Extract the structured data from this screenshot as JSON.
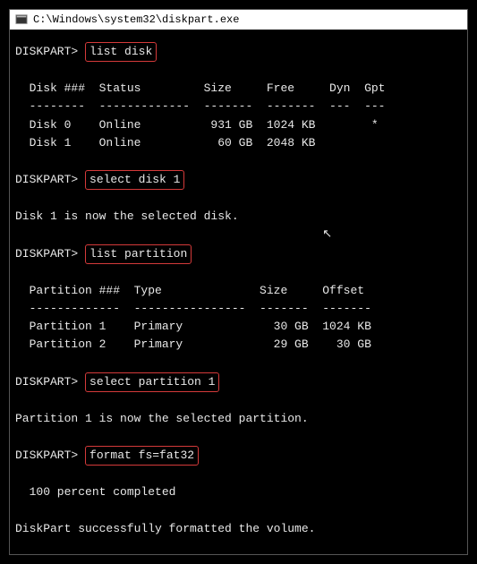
{
  "window": {
    "title": "C:\\Windows\\system32\\diskpart.exe"
  },
  "prompt": "DISKPART>",
  "commands": {
    "c1": "list disk",
    "c2": "select disk 1",
    "c3": "list partition",
    "c4": "select partition 1",
    "c5": "format fs=fat32"
  },
  "disk_table": {
    "header": "  Disk ###  Status         Size     Free     Dyn  Gpt",
    "divider": "  --------  -------------  -------  -------  ---  ---",
    "rows": [
      "  Disk 0    Online          931 GB  1024 KB        *",
      "  Disk 1    Online           60 GB  2048 KB"
    ]
  },
  "msg_disk_selected": "Disk 1 is now the selected disk.",
  "partition_table": {
    "header": "  Partition ###  Type              Size     Offset",
    "divider": "  -------------  ----------------  -------  -------",
    "rows": [
      "  Partition 1    Primary             30 GB  1024 KB",
      "  Partition 2    Primary             29 GB    30 GB"
    ]
  },
  "msg_partition_selected": "Partition 1 is now the selected partition.",
  "progress": "  100 percent completed",
  "msg_format_done": "DiskPart successfully formatted the volume.",
  "cursor_glyph": "↖"
}
